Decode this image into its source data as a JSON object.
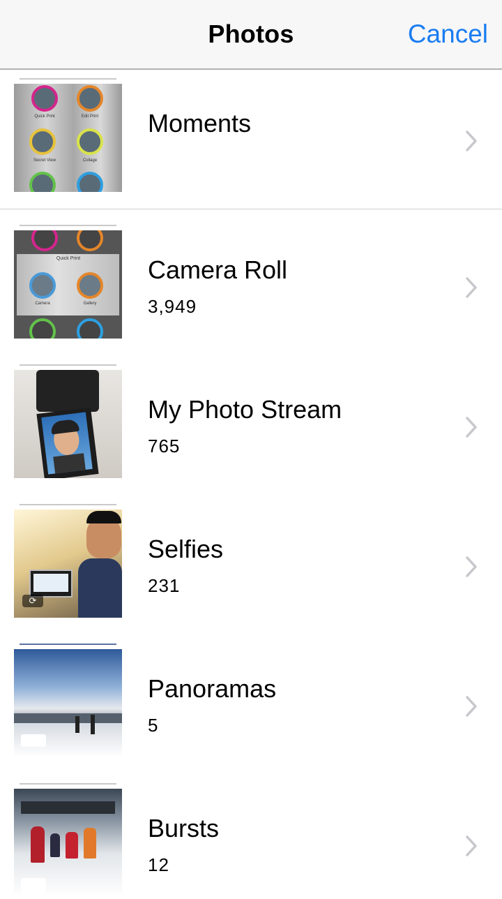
{
  "nav": {
    "title": "Photos",
    "cancel_label": "Cancel"
  },
  "albums": [
    {
      "title": "Moments",
      "count": ""
    },
    {
      "title": "Camera Roll",
      "count": "3,949"
    },
    {
      "title": "My Photo Stream",
      "count": "765"
    },
    {
      "title": "Selfies",
      "count": "231"
    },
    {
      "title": "Panoramas",
      "count": "5"
    },
    {
      "title": "Bursts",
      "count": "12"
    }
  ],
  "thumb_labels": {
    "quick_print": "Quick Print",
    "edit_print": "Edit Print",
    "secret_view": "Secret View",
    "collage": "Collage",
    "camera": "Camera",
    "gallery": "Gallery"
  },
  "colors": {
    "accent": "#1a7cf1",
    "chevron": "#c7c7cc"
  }
}
